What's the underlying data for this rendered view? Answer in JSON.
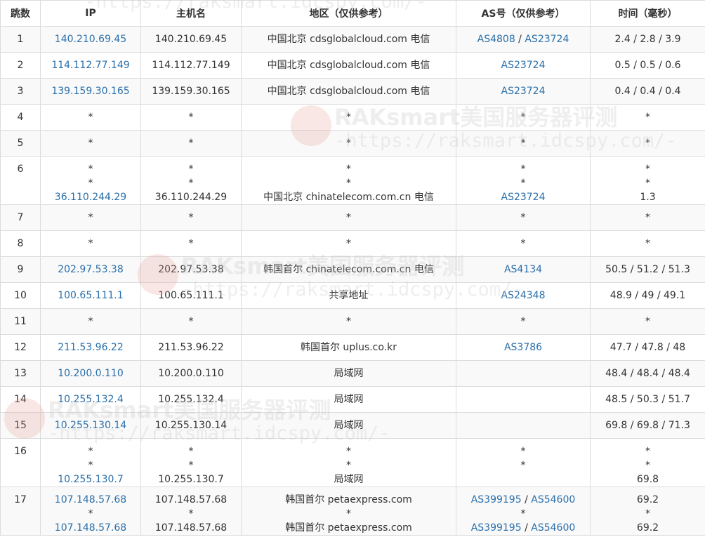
{
  "columns": [
    "跳数",
    "IP",
    "主机名",
    "地区（仅供参考）",
    "AS号（仅供参考）",
    "时间（毫秒）"
  ],
  "hops": [
    {
      "hop": "1",
      "lines": [
        {
          "ip": "140.210.69.45",
          "host": "140.210.69.45",
          "region": "中国北京 cdsglobalcloud.com 电信",
          "as": [
            "AS4808",
            "AS23724"
          ],
          "time": "2.4 / 2.8 / 3.9"
        }
      ]
    },
    {
      "hop": "2",
      "lines": [
        {
          "ip": "114.112.77.149",
          "host": "114.112.77.149",
          "region": "中国北京 cdsglobalcloud.com 电信",
          "as": [
            "AS23724"
          ],
          "time": "0.5 / 0.5 / 0.6"
        }
      ]
    },
    {
      "hop": "3",
      "lines": [
        {
          "ip": "139.159.30.165",
          "host": "139.159.30.165",
          "region": "中国北京 cdsglobalcloud.com 电信",
          "as": [
            "AS23724"
          ],
          "time": "0.4 / 0.4 / 0.4"
        }
      ]
    },
    {
      "hop": "4",
      "lines": [
        {
          "ip": "*",
          "host": "*",
          "region": "*",
          "as": [
            "*"
          ],
          "time": "*"
        }
      ]
    },
    {
      "hop": "5",
      "lines": [
        {
          "ip": "*",
          "host": "*",
          "region": "*",
          "as": [
            "*"
          ],
          "time": "*"
        }
      ]
    },
    {
      "hop": "6",
      "lines": [
        {
          "ip": "*",
          "host": "*",
          "region": "*",
          "as": [
            "*"
          ],
          "time": "*"
        },
        {
          "ip": "*",
          "host": "*",
          "region": "*",
          "as": [
            "*"
          ],
          "time": "*"
        },
        {
          "ip": "36.110.244.29",
          "host": "36.110.244.29",
          "region": "中国北京 chinatelecom.com.cn 电信",
          "as": [
            "AS23724"
          ],
          "time": "1.3"
        }
      ]
    },
    {
      "hop": "7",
      "lines": [
        {
          "ip": "*",
          "host": "*",
          "region": "*",
          "as": [
            "*"
          ],
          "time": "*"
        }
      ]
    },
    {
      "hop": "8",
      "lines": [
        {
          "ip": "*",
          "host": "*",
          "region": "*",
          "as": [
            "*"
          ],
          "time": "*"
        }
      ]
    },
    {
      "hop": "9",
      "lines": [
        {
          "ip": "202.97.53.38",
          "host": "202.97.53.38",
          "region": "韩国首尔 chinatelecom.com.cn 电信",
          "as": [
            "AS4134"
          ],
          "time": "50.5 / 51.2 / 51.3"
        }
      ]
    },
    {
      "hop": "10",
      "lines": [
        {
          "ip": "100.65.111.1",
          "host": "100.65.111.1",
          "region": "共享地址",
          "as": [
            "AS24348"
          ],
          "time": "48.9 / 49 / 49.1"
        }
      ]
    },
    {
      "hop": "11",
      "lines": [
        {
          "ip": "*",
          "host": "*",
          "region": "*",
          "as": [
            "*"
          ],
          "time": "*"
        }
      ]
    },
    {
      "hop": "12",
      "lines": [
        {
          "ip": "211.53.96.22",
          "host": "211.53.96.22",
          "region": "韩国首尔 uplus.co.kr",
          "as": [
            "AS3786"
          ],
          "time": "47.7 / 47.8 / 48"
        }
      ]
    },
    {
      "hop": "13",
      "lines": [
        {
          "ip": "10.200.0.110",
          "host": "10.200.0.110",
          "region": "局域网",
          "as": [],
          "time": "48.4 / 48.4 / 48.4"
        }
      ]
    },
    {
      "hop": "14",
      "lines": [
        {
          "ip": "10.255.132.4",
          "host": "10.255.132.4",
          "region": "局域网",
          "as": [],
          "time": "48.5 / 50.3 / 51.7"
        }
      ]
    },
    {
      "hop": "15",
      "lines": [
        {
          "ip": "10.255.130.14",
          "host": "10.255.130.14",
          "region": "局域网",
          "as": [],
          "time": "69.8 / 69.8 / 71.3"
        }
      ]
    },
    {
      "hop": "16",
      "lines": [
        {
          "ip": "*",
          "host": "*",
          "region": "*",
          "as": [
            "*"
          ],
          "time": "*"
        },
        {
          "ip": "*",
          "host": "*",
          "region": "*",
          "as": [
            "*"
          ],
          "time": "*"
        },
        {
          "ip": "10.255.130.7",
          "host": "10.255.130.7",
          "region": "局域网",
          "as": [],
          "time": "69.8"
        }
      ]
    },
    {
      "hop": "17",
      "lines": [
        {
          "ip": "107.148.57.68",
          "host": "107.148.57.68",
          "region": "韩国首尔 petaexpress.com",
          "as": [
            "AS399195",
            "AS54600"
          ],
          "time": "69.2"
        },
        {
          "ip": "*",
          "host": "*",
          "region": "*",
          "as": [
            "*"
          ],
          "time": "*"
        },
        {
          "ip": "107.148.57.68",
          "host": "107.148.57.68",
          "region": "韩国首尔 petaexpress.com",
          "as": [
            "AS399195",
            "AS54600"
          ],
          "time": "69.2"
        }
      ]
    }
  ],
  "watermark": {
    "title": "RAKsmart美国服务器评测",
    "url": "-https://raksmart.idcspy.com/-"
  },
  "colors": {
    "link": "#2a6faa",
    "border": "#dcdcdc",
    "row_stripe": "#f9f9f9"
  }
}
